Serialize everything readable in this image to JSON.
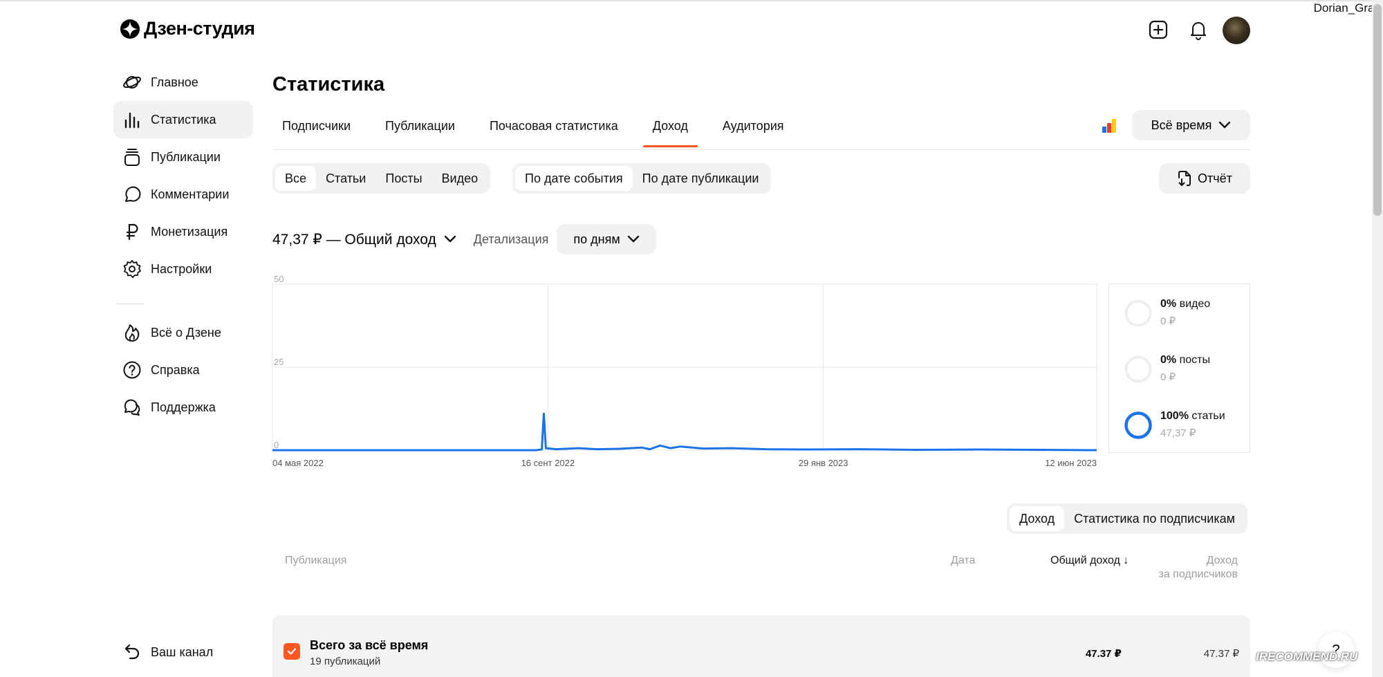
{
  "watermark_user": "Dorian_Gray",
  "logo": {
    "text": "Дзен-студия"
  },
  "header": {
    "add_icon": "plus-square-icon",
    "bell_icon": "bell-icon"
  },
  "sidebar": {
    "items": [
      {
        "label": "Главное",
        "icon": "planet-icon"
      },
      {
        "label": "Статистика",
        "icon": "bar-chart-icon",
        "active": true
      },
      {
        "label": "Публикации",
        "icon": "stack-icon"
      },
      {
        "label": "Комментарии",
        "icon": "comment-icon"
      },
      {
        "label": "Монетизация",
        "icon": "ruble-icon"
      },
      {
        "label": "Настройки",
        "icon": "gear-icon"
      }
    ],
    "secondary": [
      {
        "label": "Всё о Дзене",
        "icon": "flame-icon"
      },
      {
        "label": "Справка",
        "icon": "question-circle-icon"
      },
      {
        "label": "Поддержка",
        "icon": "chat-bubbles-icon"
      }
    ],
    "bottom": {
      "label": "Ваш канал",
      "icon": "return-icon"
    }
  },
  "page": {
    "title": "Статистика"
  },
  "tabs": [
    {
      "label": "Подписчики"
    },
    {
      "label": "Публикации"
    },
    {
      "label": "Почасовая статистика"
    },
    {
      "label": "Доход",
      "active": true
    },
    {
      "label": "Аудитория"
    }
  ],
  "period": {
    "label": "Всё время"
  },
  "content_filter": [
    "Все",
    "Статьи",
    "Посты",
    "Видео"
  ],
  "date_filter": [
    "По дате события",
    "По дате публикации"
  ],
  "report_button": "Отчёт",
  "total": {
    "label": "47,37 ₽ — Общий доход"
  },
  "detail": {
    "label": "Детализация",
    "value": "по дням"
  },
  "chart_data": {
    "type": "line",
    "series_color": "#1a73e8",
    "x_ticks": [
      "04 мая 2022",
      "16 сент 2022",
      "29 янв 2023",
      "12 июн 2023"
    ],
    "y_ticks": [
      "50",
      "25",
      "0"
    ],
    "ylim": [
      0,
      50
    ],
    "grid": true,
    "points": [
      [
        "04 мая 2022",
        0
      ],
      [
        "20 июл 2022",
        0
      ],
      [
        "10 сент 2022",
        0
      ],
      [
        "13 сент 2022",
        0.2
      ],
      [
        "14 сент 2022",
        11
      ],
      [
        "15 сент 2022",
        0.6
      ],
      [
        "20 сент 2022",
        0.3
      ],
      [
        "01 окт 2022",
        0.6
      ],
      [
        "10 окт 2022",
        0.3
      ],
      [
        "20 окт 2022",
        0.4
      ],
      [
        "01 ноя 2022",
        0.8
      ],
      [
        "05 ноя 2022",
        0.3
      ],
      [
        "10 ноя 2022",
        1.4
      ],
      [
        "15 ноя 2022",
        0.6
      ],
      [
        "20 ноя 2022",
        1.1
      ],
      [
        "01 дек 2022",
        0.5
      ],
      [
        "15 дек 2022",
        0.6
      ],
      [
        "01 янв 2023",
        0.3
      ],
      [
        "20 янв 2023",
        0.2
      ],
      [
        "15 фев 2023",
        0.3
      ],
      [
        "15 мар 2023",
        0.1
      ],
      [
        "15 апр 2023",
        0.2
      ],
      [
        "15 май 2023",
        0.1
      ],
      [
        "12 июн 2023",
        0
      ]
    ]
  },
  "breakdown": [
    {
      "pct": "0%",
      "name": "видео",
      "sum": "0 ₽",
      "fraction": 0
    },
    {
      "pct": "0%",
      "name": "посты",
      "sum": "0 ₽",
      "fraction": 0
    },
    {
      "pct": "100%",
      "name": "статьи",
      "sum": "47,37 ₽",
      "fraction": 1
    }
  ],
  "table": {
    "switch": [
      "Доход",
      "Статистика по подписчикам"
    ],
    "headers": {
      "publication": "Публикация",
      "date": "Дата",
      "total": "Общий доход ↓",
      "subs_line1": "Доход",
      "subs_line2": "за подписчиков"
    },
    "summary": {
      "title": "Всего за всё время",
      "subtitle": "19 публикаций",
      "total": "47.37 ₽",
      "subs": "47.37 ₽"
    }
  },
  "help_button": "?",
  "watermark": "IRECOMMEND.RU"
}
